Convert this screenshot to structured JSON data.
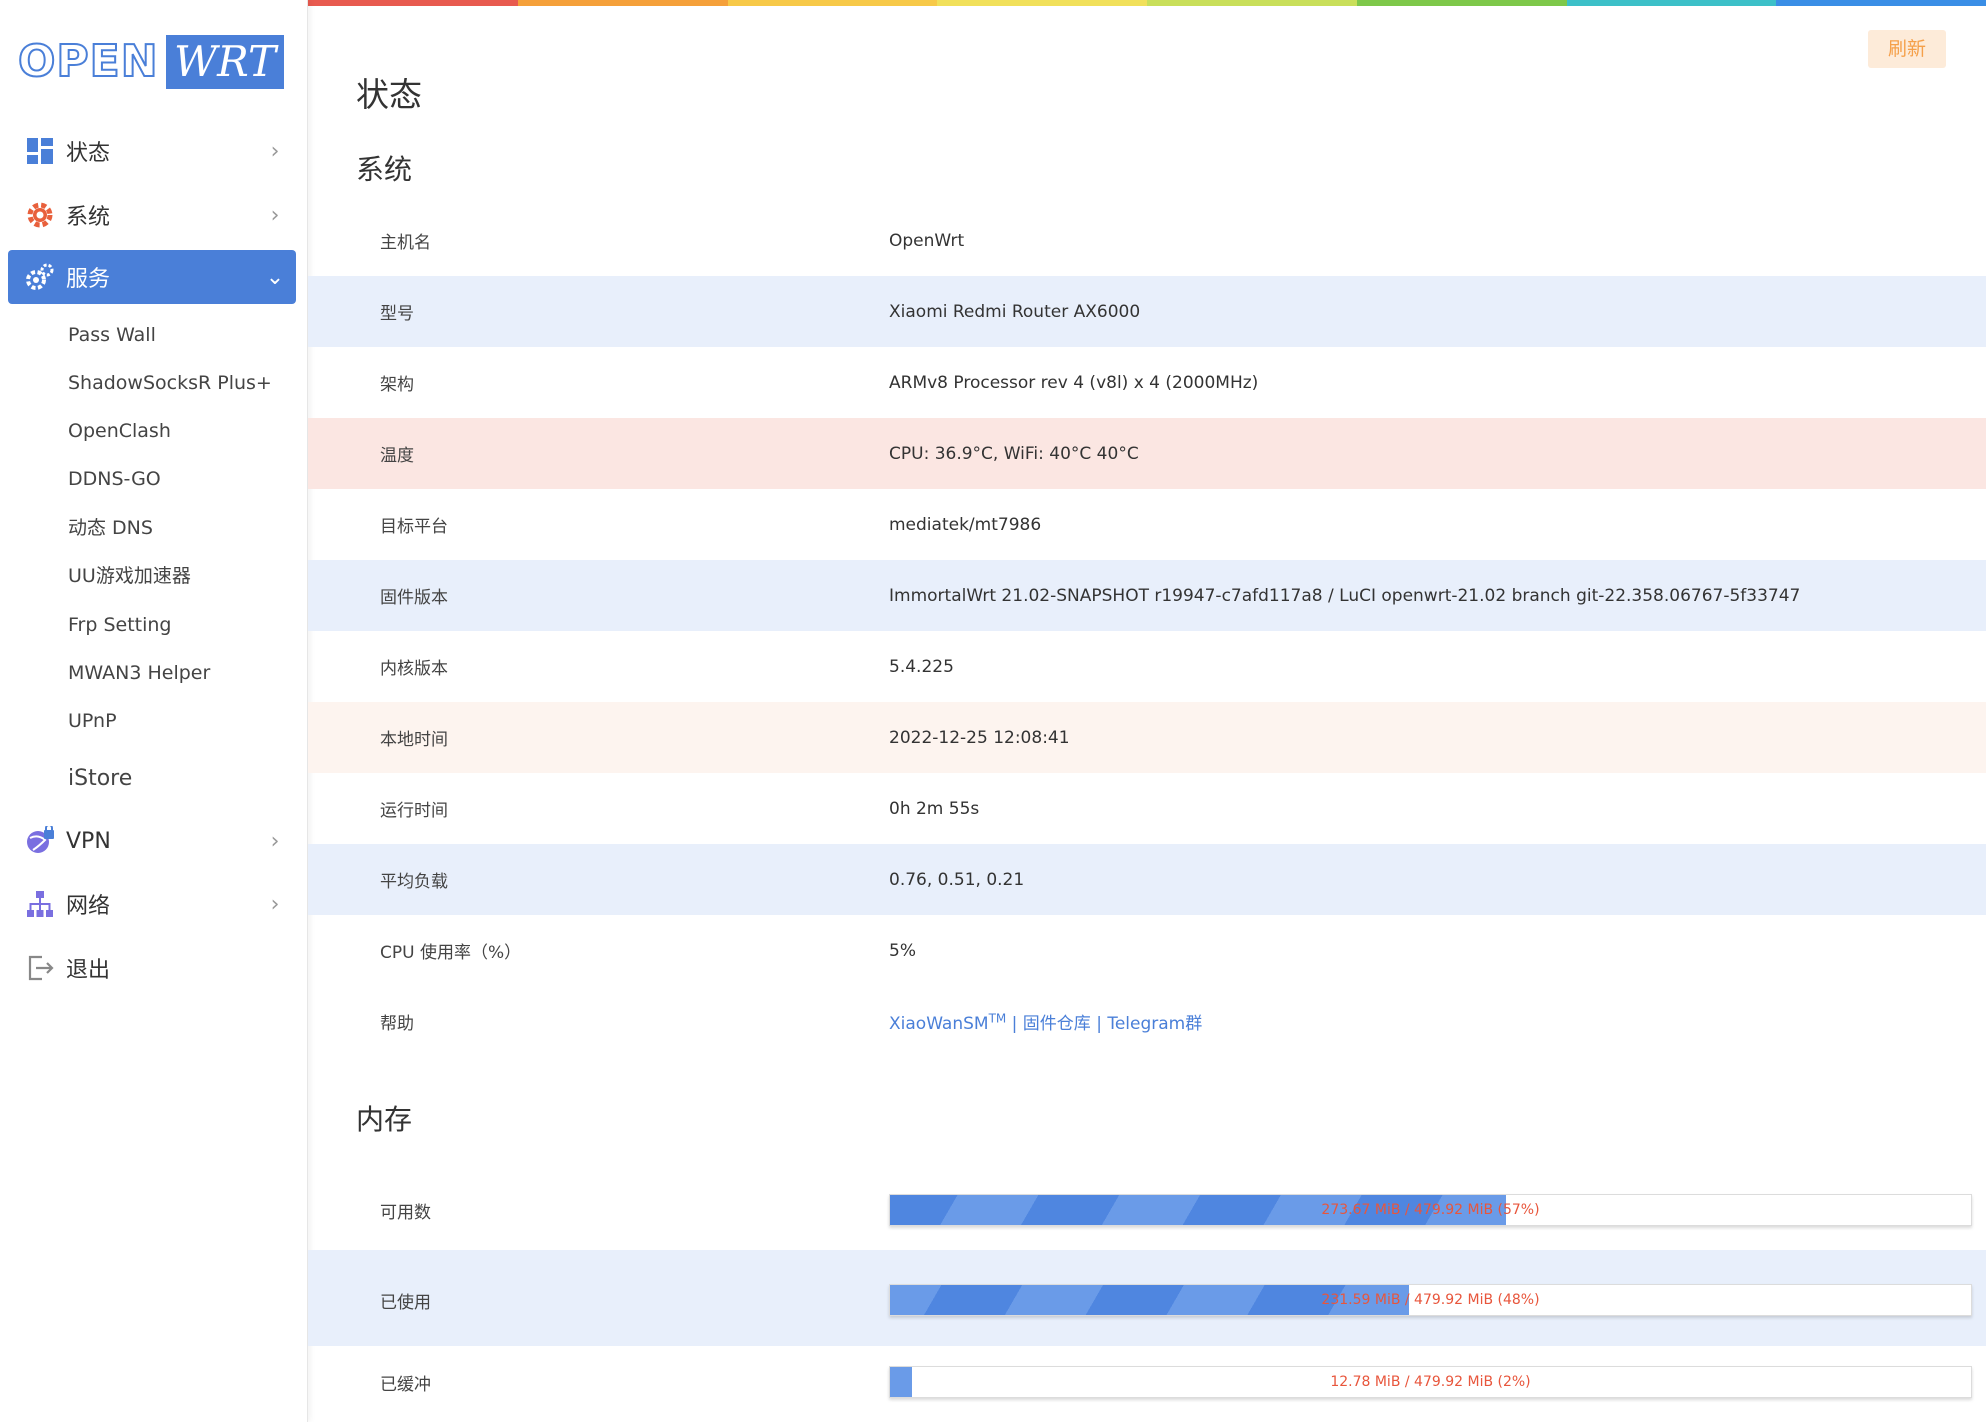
{
  "colors": {
    "accent": "#4a7fd8",
    "rainbow": [
      "#e85a4f",
      "#f5a03a",
      "#f7c948",
      "#f1e05a",
      "#c9df5a",
      "#7ec84a",
      "#3cc0c8",
      "#3a8ee6"
    ]
  },
  "logo": {
    "open": "OPEN",
    "wrt": "WRT"
  },
  "sidebar": {
    "items": [
      {
        "label": "状态",
        "icon": "dashboard-icon"
      },
      {
        "label": "系统",
        "icon": "gear-icon"
      },
      {
        "label": "服务",
        "icon": "gears-icon"
      },
      {
        "label": "VPN",
        "icon": "globe-lock-icon"
      },
      {
        "label": "网络",
        "icon": "network-icon"
      },
      {
        "label": "退出",
        "icon": "logout-icon"
      }
    ],
    "service_subitems": [
      "Pass Wall",
      "ShadowSocksR Plus+",
      "OpenClash",
      "DDNS-GO",
      "动态 DNS",
      "UU游戏加速器",
      "Frp Setting",
      "MWAN3 Helper",
      "UPnP"
    ],
    "istore": "iStore"
  },
  "header": {
    "refresh_label": "刷新"
  },
  "page_title": "状态",
  "system": {
    "title": "系统",
    "rows": [
      {
        "key": "主机名",
        "value": "OpenWrt"
      },
      {
        "key": "型号",
        "value": "Xiaomi Redmi Router AX6000"
      },
      {
        "key": "架构",
        "value": "ARMv8 Processor rev 4 (v8l) x 4 (2000MHz)"
      },
      {
        "key": "温度",
        "value": "CPU: 36.9°C, WiFi: 40°C 40°C"
      },
      {
        "key": "目标平台",
        "value": "mediatek/mt7986"
      },
      {
        "key": "固件版本",
        "value": "ImmortalWrt 21.02-SNAPSHOT r19947-c7afd117a8 / LuCI openwrt-21.02 branch git-22.358.06767-5f33747"
      },
      {
        "key": "内核版本",
        "value": "5.4.225"
      },
      {
        "key": "本地时间",
        "value": "2022-12-25 12:08:41"
      },
      {
        "key": "运行时间",
        "value": "0h 2m 55s"
      },
      {
        "key": "平均负载",
        "value": "0.76, 0.51, 0.21"
      },
      {
        "key": "CPU 使用率（%）",
        "value": "5%"
      }
    ],
    "help": {
      "key": "帮助",
      "link1": "XiaoWanSM",
      "tm": "TM",
      "sep1": " | ",
      "link2": "固件仓库",
      "sep2": " | ",
      "link3": "Telegram群"
    }
  },
  "memory": {
    "title": "内存",
    "rows": [
      {
        "key": "可用数",
        "text": "273.67 MiB / 479.92 MiB (57%)",
        "percent": 57
      },
      {
        "key": "已使用",
        "text": "231.59 MiB / 479.92 MiB (48%)",
        "percent": 48
      },
      {
        "key": "已缓冲",
        "text": "12.78 MiB / 479.92 MiB (2%)",
        "percent": 2
      }
    ]
  }
}
